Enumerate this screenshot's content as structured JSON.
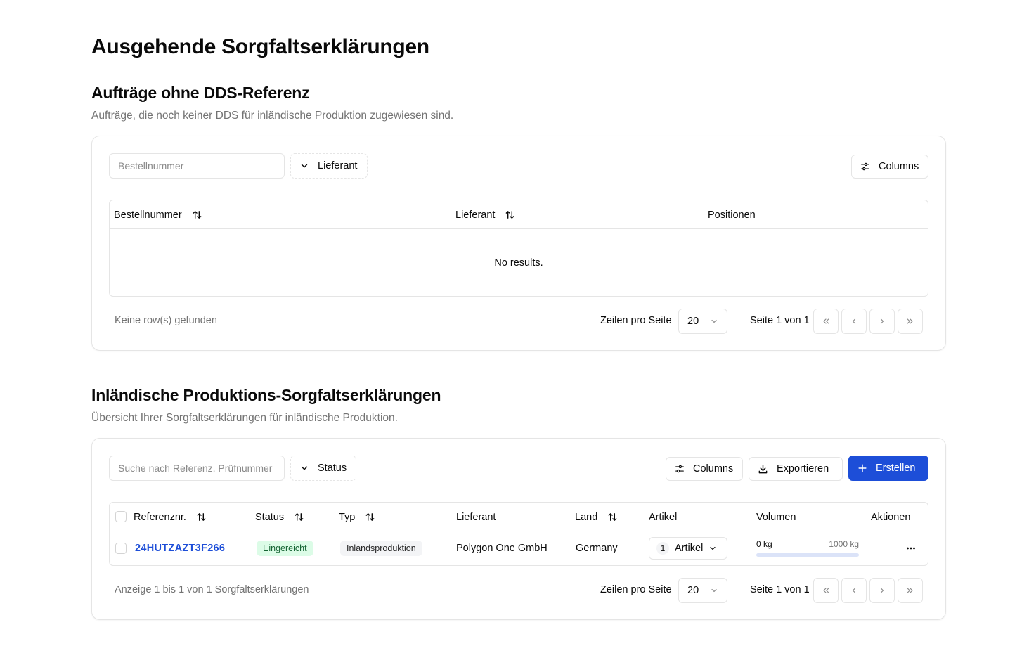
{
  "page": {
    "title": "Ausgehende Sorgfaltserklärungen"
  },
  "section1": {
    "title": "Aufträge ohne DDS-Referenz",
    "description": "Aufträge, die noch keiner DDS für inländische Produktion zugewiesen sind.",
    "search_placeholder": "Bestellnummer",
    "filter_label": "Lieferant",
    "columns_label": "Columns",
    "headers": [
      "Bestellnummer",
      "Lieferant",
      "Positionen"
    ],
    "empty_text": "No results.",
    "footer": {
      "summary": "Keine row(s) gefunden",
      "rows_per_page_label": "Zeilen pro Seite",
      "rows_per_page_value": "20",
      "page_info": "Seite 1 von 1"
    }
  },
  "section2": {
    "title": "Inländische Produktions-Sorgfaltserklärungen",
    "description": "Übersicht Ihrer Sorgfaltserklärungen für inländische Produktion.",
    "search_placeholder": "Suche nach Referenz, Prüfnummer",
    "filter_label": "Status",
    "columns_label": "Columns",
    "export_label": "Exportieren",
    "create_label": "Erstellen",
    "headers": [
      "Referenznr.",
      "Status",
      "Typ",
      "Lieferant",
      "Land",
      "Artikel",
      "Volumen",
      "Aktionen"
    ],
    "rows": [
      {
        "reference": "24HUTZAZT3F266",
        "status": "Eingereicht",
        "type": "Inlandsproduktion",
        "supplier": "Polygon One GmbH",
        "country": "Germany",
        "article_count": "1",
        "article_label": "Artikel",
        "volume_min": "0 kg",
        "volume_max": "1000 kg",
        "volume_fraction": 0
      }
    ],
    "footer": {
      "summary": "Anzeige 1 bis 1 von 1 Sorgfaltserklärungen",
      "rows_per_page_label": "Zeilen pro Seite",
      "rows_per_page_value": "20",
      "page_info": "Seite 1 von 1"
    }
  },
  "colors": {
    "primary": "#1d4ed8",
    "badge_green_bg": "#dcfce7",
    "badge_green_text": "#166534",
    "muted_text": "#737373",
    "border": "#e5e5e5"
  }
}
